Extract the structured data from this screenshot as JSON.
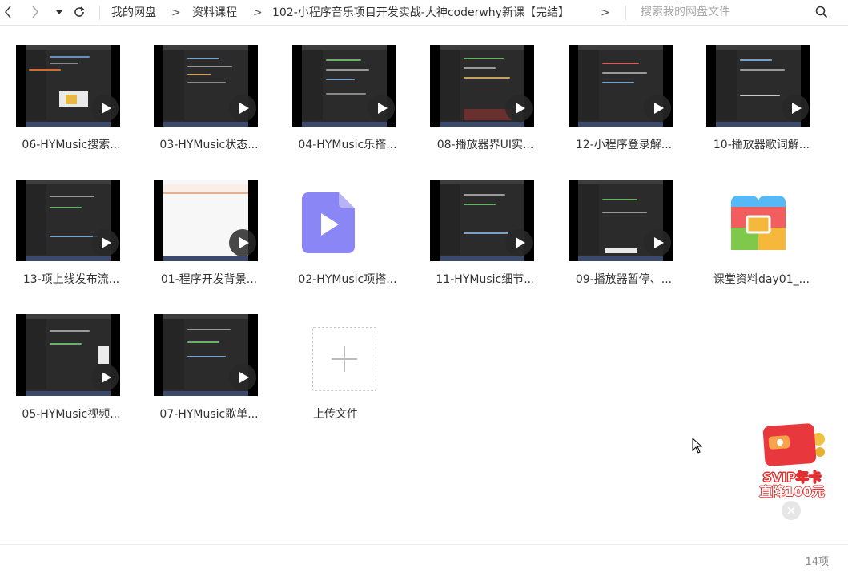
{
  "nav": {
    "back_icon": "chevron-left-icon",
    "forward_icon": "chevron-right-icon",
    "dropdown_icon": "caret-down-icon",
    "refresh_icon": "refresh-icon"
  },
  "breadcrumb": {
    "items": [
      "我的网盘",
      "资料课程",
      "102-小程序音乐项目开发实战-大神coderwhy新课【完结】"
    ],
    "separator": ">"
  },
  "search": {
    "placeholder": "搜索我的网盘文件",
    "icon": "search-icon"
  },
  "files": [
    {
      "name": "06-HYMusic搜索...",
      "type": "video"
    },
    {
      "name": "03-HYMusic状态...",
      "type": "video"
    },
    {
      "name": "04-HYMusic乐搭...",
      "type": "video"
    },
    {
      "name": "08-播放器界UI实...",
      "type": "video"
    },
    {
      "name": "12-小程序登录解...",
      "type": "video"
    },
    {
      "name": "10-播放器歌词解...",
      "type": "video"
    },
    {
      "name": "13-项上线发布流...",
      "type": "video"
    },
    {
      "name": "01-程序开发背景...",
      "type": "video"
    },
    {
      "name": "02-HYMusic项搭...",
      "type": "video-file-icon"
    },
    {
      "name": "11-HYMusic细节...",
      "type": "video"
    },
    {
      "name": "09-播放器暂停、...",
      "type": "video"
    },
    {
      "name": "课堂资料day01_...",
      "type": "archive"
    },
    {
      "name": "05-HYMusic视频...",
      "type": "video"
    },
    {
      "name": "07-HYMusic歌单...",
      "type": "video"
    }
  ],
  "upload": {
    "label": "上传文件",
    "icon": "plus-icon"
  },
  "promo": {
    "line1": "SVIP年卡",
    "line2": "直降100元",
    "close_icon": "close-icon"
  },
  "status": {
    "count": "14项"
  },
  "colors": {
    "accent_play": "#2b2b2b",
    "video_icon": "#8b86f5",
    "promo_red": "#e8383d"
  }
}
